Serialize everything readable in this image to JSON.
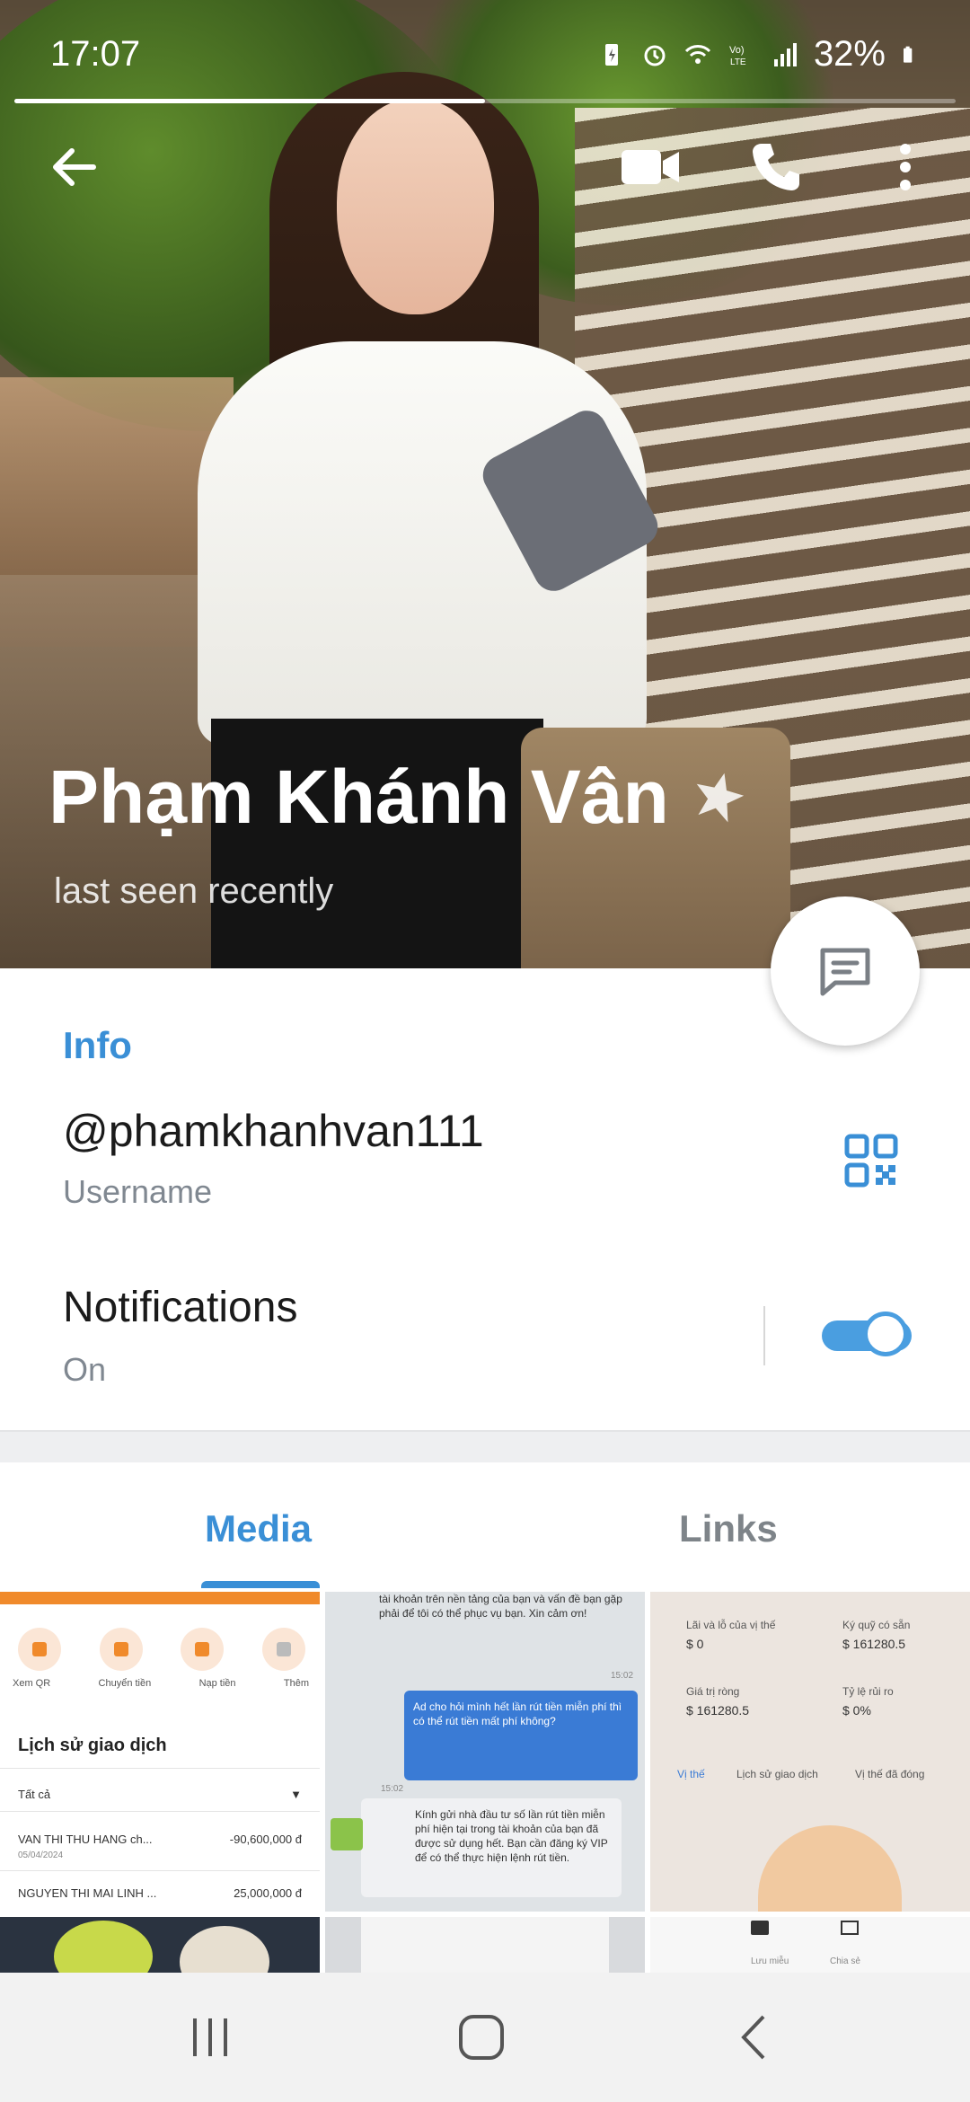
{
  "status_bar": {
    "time": "17:07",
    "battery": "32%",
    "icons": [
      "battery-saver-icon",
      "alarm-icon",
      "wifi-icon",
      "volte-icon",
      "signal-icon",
      "battery-icon"
    ]
  },
  "story_progress": 0.5,
  "header": {
    "back_icon": "back-arrow-icon",
    "video_call_icon": "video-camera-icon",
    "call_icon": "phone-icon",
    "more_icon": "more-vertical-icon"
  },
  "profile": {
    "name": "Phạm Khánh Vân",
    "badge_icon": "star-icon",
    "status": "last seen recently",
    "fab_icon": "message-icon"
  },
  "info": {
    "title": "Info",
    "username": "@phamkhanhvan111",
    "username_label": "Username",
    "qr_icon": "qr-code-icon",
    "notifications_label": "Notifications",
    "notifications_value": "On",
    "notifications_enabled": true
  },
  "tabs": [
    {
      "label": "Media",
      "active": true
    },
    {
      "label": "Links",
      "active": false
    }
  ],
  "media_thumbs": {
    "t1": {
      "icon_labels": [
        "Xem QR",
        "Chuyển tiền",
        "Nạp tiền",
        "Thêm"
      ],
      "heading": "Lịch sử giao dịch",
      "filter": "Tất cả",
      "rows": [
        {
          "name": "VAN THI THU HANG ch...",
          "date": "05/04/2024",
          "amount": "-90,600,000 đ"
        },
        {
          "name": "NGUYEN THI MAI LINH ...",
          "date": "",
          "amount": "25,000,000 đ"
        }
      ]
    },
    "t2": {
      "top_text": "tài khoản trên nền tảng của bạn và vấn đề bạn gặp phải để tôi có thể phục vụ bạn. Xin cảm ơn!",
      "time1": "15:02",
      "blue_bubble": "Ad cho hỏi mình hết lần rút tiền miễn phí thì có thể rút tiền mất phí không?",
      "time2": "15:02",
      "reply": "Kính gửi nhà đầu tư số lần rút tiền miễn phí hiện tại trong tài khoản của bạn đã được sử dụng hết. Bạn cần đăng ký VIP để có thể thực hiện lệnh rút tiền."
    },
    "t3": {
      "labels": [
        "Lãi và lỗ của vị thế",
        "Ký quỹ có sẵn",
        "Giá trị ròng",
        "Tỷ lệ rủi ro"
      ],
      "values": [
        "$ 0",
        "$ 161280.5",
        "$ 161280.5",
        "$ 0%"
      ],
      "tabs": [
        "Vị thế",
        "Lịch sử giao dịch",
        "Vị thế đã đóng"
      ]
    },
    "t6": {
      "labels": [
        "Lưu miễu",
        "Chia sẻ"
      ]
    }
  },
  "nav_bar": {
    "icons": [
      "recents-icon",
      "home-icon",
      "back-icon"
    ]
  },
  "colors": {
    "accent": "#3a8fd6",
    "toggle": "#4a9ee0",
    "muted_text": "#808891"
  }
}
